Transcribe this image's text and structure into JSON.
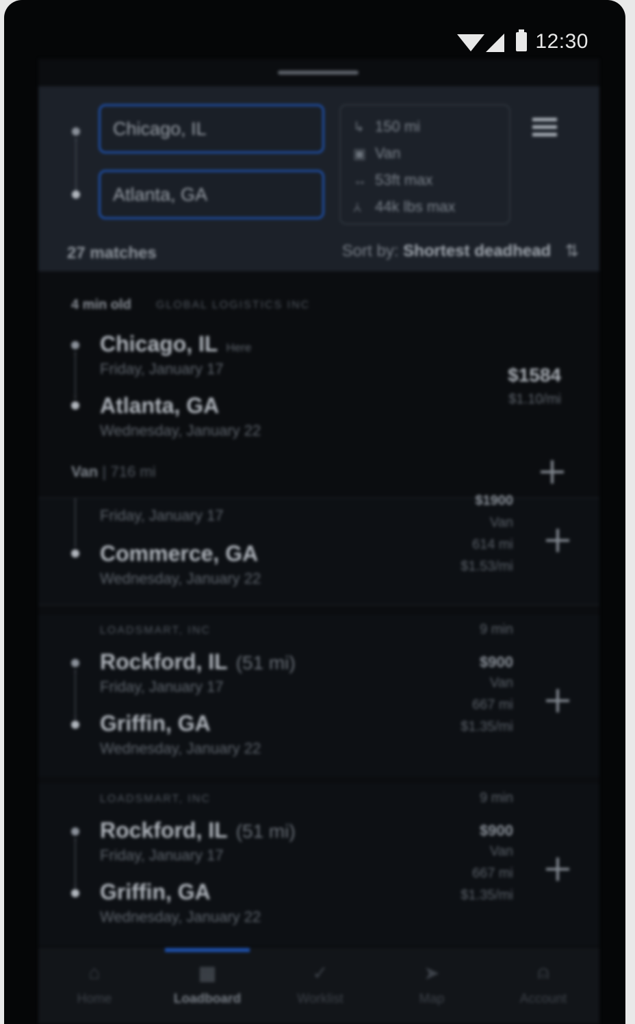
{
  "status_bar": {
    "time": "12:30"
  },
  "search": {
    "origin": "Chicago, IL",
    "destination": "Atlanta, GA",
    "filters": [
      {
        "icon": "deadhead-icon",
        "glyph": "↳",
        "label": "150 mi"
      },
      {
        "icon": "truck-icon",
        "glyph": "▣",
        "label": "Van"
      },
      {
        "icon": "length-icon",
        "glyph": "↔",
        "label": "53ft max"
      },
      {
        "icon": "weight-icon",
        "glyph": "⩑",
        "label": "44k lbs max"
      }
    ]
  },
  "results": {
    "count": "27 matches",
    "sort_prefix": "Sort by",
    "sort_value": "Shortest deadhead"
  },
  "loads": [
    {
      "age": "4 min old",
      "broker": "GLOBAL LOGISTICS INC",
      "origin": "Chicago, IL",
      "origin_note": "Here",
      "pickup_date": "Friday, January 17",
      "destination": "Atlanta, GA",
      "delivery_date": "Wednesday, January 22",
      "rate": "$1584",
      "rate_per_mile": "$1.10/mi",
      "equipment": "Van",
      "distance": "716 mi"
    },
    {
      "age": "",
      "broker": "",
      "origin": "",
      "pickup_date": "Friday, January 17",
      "destination": "Commerce, GA",
      "delivery_date": "Wednesday, January 22",
      "rate": "$1900",
      "equipment": "Van",
      "distance": "614 mi",
      "rate_per_mile": "$1.53/mi"
    },
    {
      "age": "9 min",
      "broker": "LOADSMART, INC",
      "origin": "Rockford, IL",
      "origin_note": "(51 mi)",
      "pickup_date": "Friday, January 17",
      "destination": "Griffin, GA",
      "delivery_date": "Wednesday, January 22",
      "rate": "$900",
      "equipment": "Van",
      "distance": "667 mi",
      "rate_per_mile": "$1.35/mi"
    },
    {
      "age": "9 min",
      "broker": "LOADSMART, INC",
      "origin": "Rockford, IL",
      "origin_note": "(51 mi)",
      "pickup_date": "Friday, January 17",
      "destination": "Griffin, GA",
      "delivery_date": "Wednesday, January 22",
      "rate": "$900",
      "equipment": "Van",
      "distance": "667 mi",
      "rate_per_mile": "$1.35/mi"
    }
  ],
  "nav": {
    "items": [
      {
        "label": "Home",
        "glyph": "⌂"
      },
      {
        "label": "Loadboard",
        "glyph": "▦"
      },
      {
        "label": "Worklist",
        "glyph": "✓"
      },
      {
        "label": "Map",
        "glyph": "➤"
      },
      {
        "label": "Account",
        "glyph": "⍝"
      }
    ],
    "active": "Loadboard"
  },
  "colors": {
    "accent": "#1d4fa8",
    "background": "#0b0d10",
    "panel": "#1c2129"
  }
}
